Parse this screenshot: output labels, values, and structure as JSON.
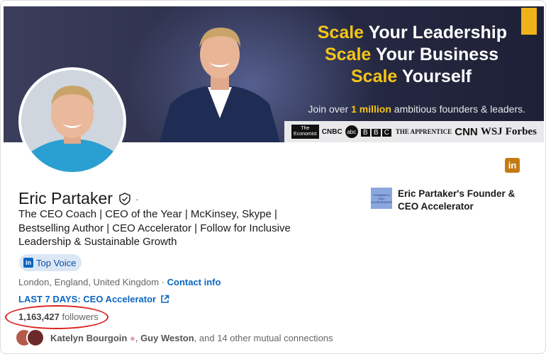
{
  "banner": {
    "line1_accent": "Scale",
    "line1_rest": " Your Leadership",
    "line2_accent": "Scale",
    "line2_rest": " Your Business",
    "line3_accent": "Scale",
    "line3_rest": " Yourself",
    "join_prefix": "Join over ",
    "join_accent": "1 million",
    "join_suffix": " ambitious founders & leaders.",
    "media_logos": [
      "The Economist",
      "CNBC",
      "abc",
      "BBC",
      "The Apprentice",
      "CNN",
      "WSJ",
      "Forbes"
    ],
    "accent_color": "#f5c518"
  },
  "profile": {
    "name": "Eric Partaker",
    "name_dot": "·",
    "tagline": "The CEO Coach | CEO of the Year | McKinsey, Skype | Bestselling Author | CEO Accelerator | Follow for Inclusive Leadership & Sustainable Growth",
    "badge": "Top Voice",
    "location": "London, England, United Kingdom",
    "location_sep": " · ",
    "contact_info": "Contact info",
    "featured_link": "LAST 7 DAYS: CEO Accelerator",
    "followers_count": "1,163,427",
    "followers_label": " followers",
    "mutual": {
      "name1": "Katelyn Bourgoin",
      "sep1": ", ",
      "name2": "Guy Weston",
      "rest": ", and 14 other mutual connections"
    }
  },
  "company": {
    "name": "Eric Partaker's Founder & CEO Accelerator",
    "logo_text": "FOUNDER & CEO ACCELERATOR"
  },
  "icons": {
    "linkedin": "in",
    "topvoice": "in"
  }
}
